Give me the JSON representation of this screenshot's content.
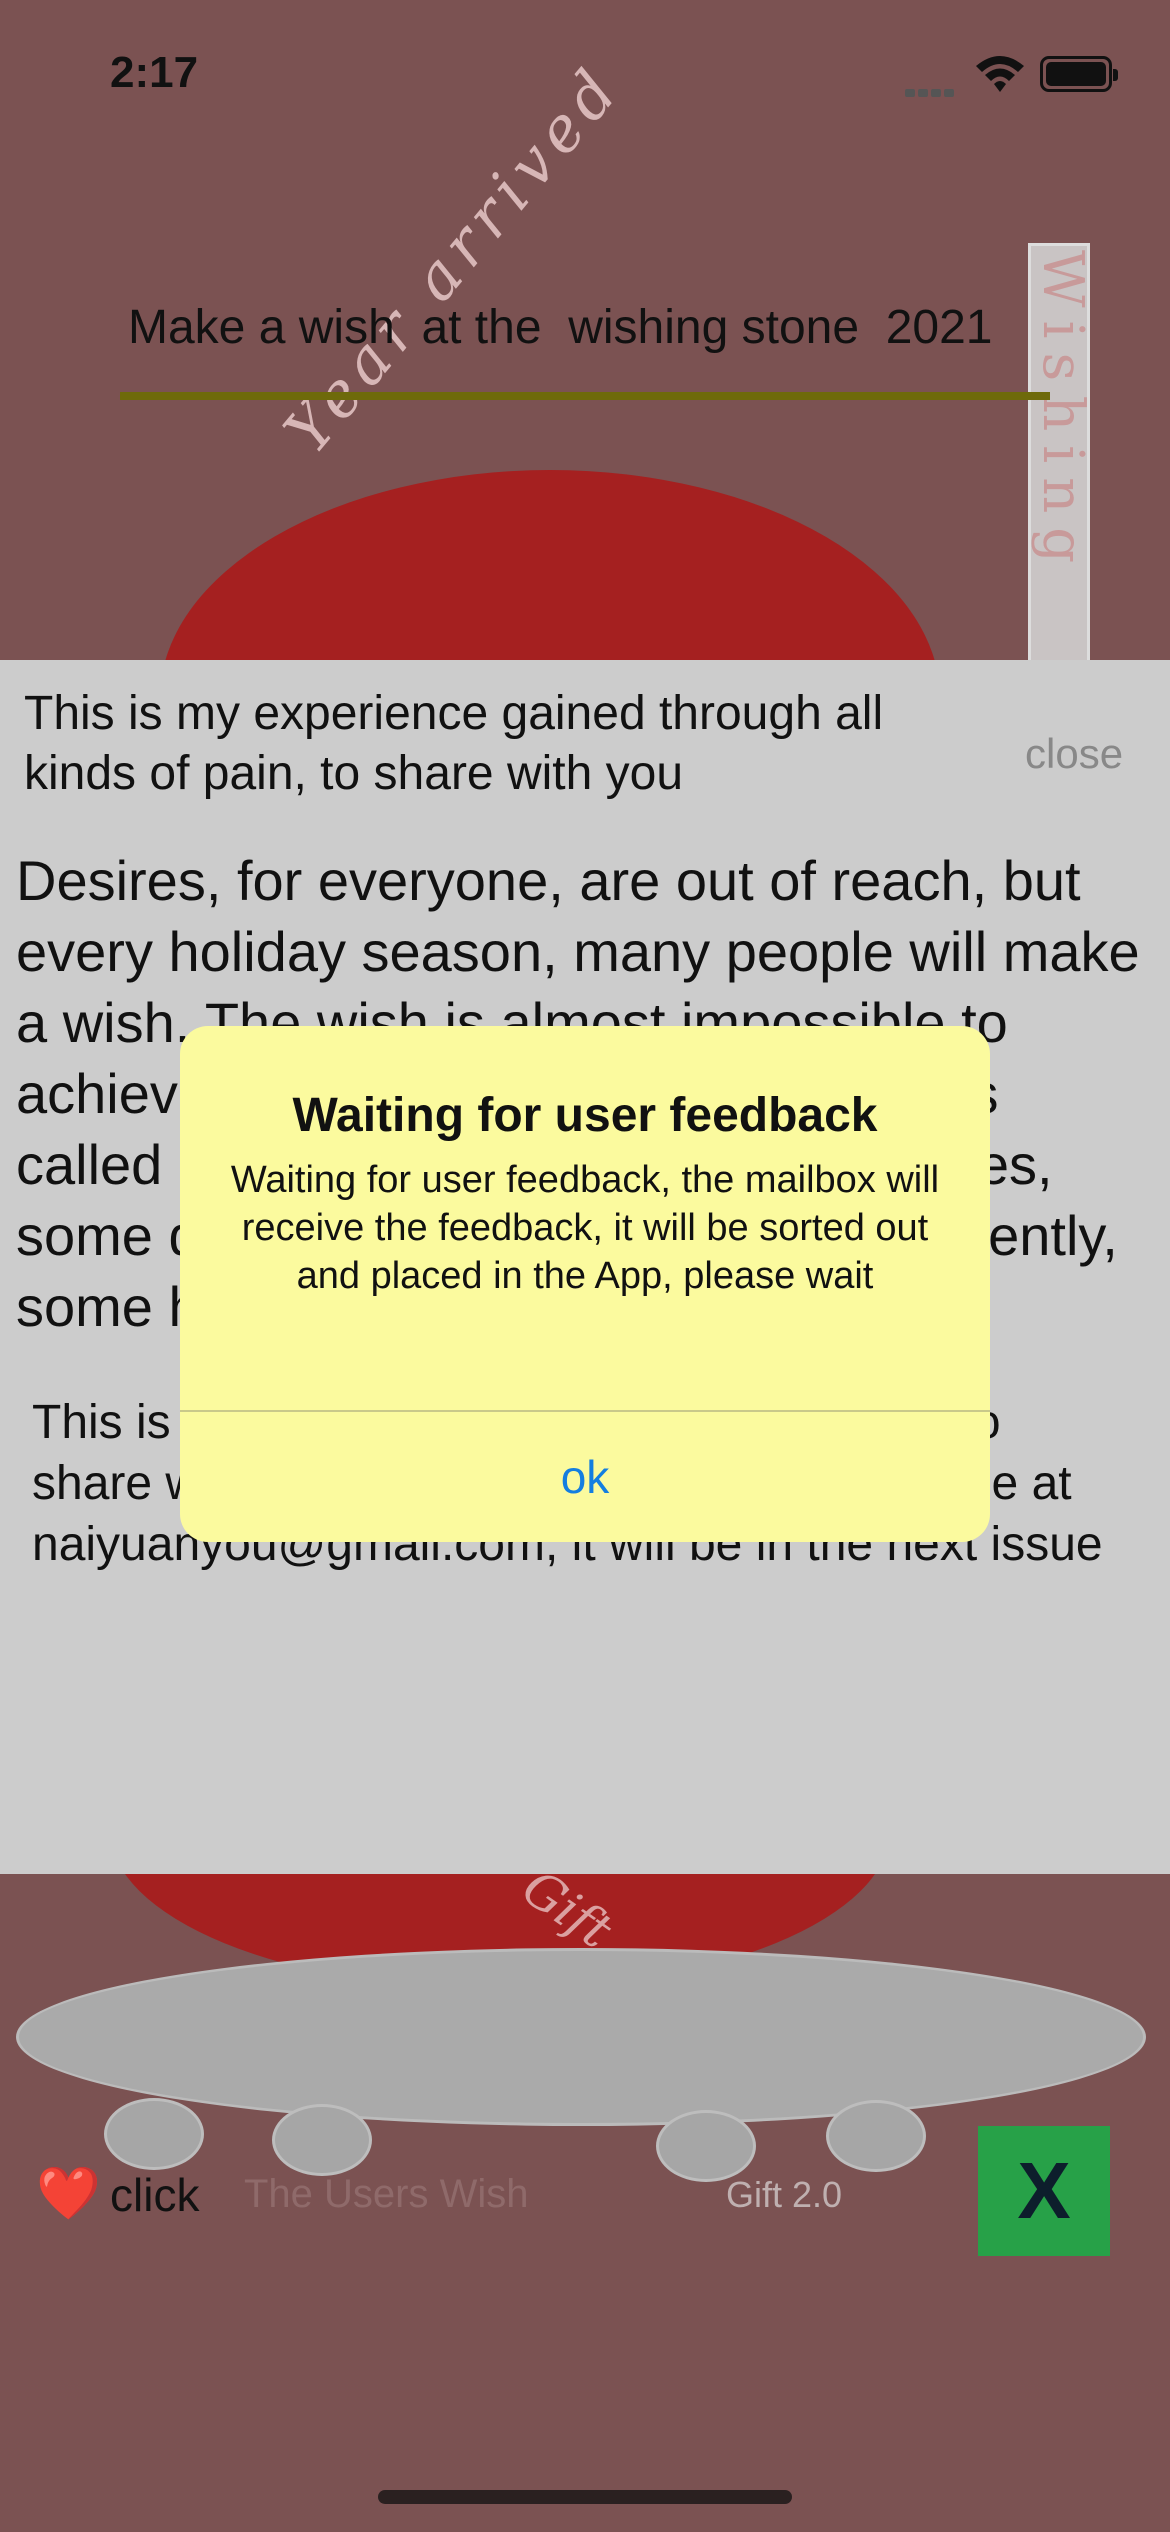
{
  "status_bar": {
    "time": "2:17",
    "icons": [
      "signal-dots-icon",
      "wifi-icon",
      "battery-icon"
    ]
  },
  "header": {
    "title": "Make a wish  at the  wishing stone  2021"
  },
  "decor": {
    "sign_text": "Wishing",
    "arc_text": "Year arrived",
    "gift_text": "Gift"
  },
  "panel": {
    "header": "This is my experience gained through all kinds of pain, to share with you",
    "close_label": "close",
    "body": "Desires, for everyone, are out of reach, but every holiday season, many people will make a wish. The wish is almost impossible to achieve, a wish that is difficult to fulfill is called a wish. Some people make wishes, some quietly, some silently, some frequently, some hope for the best, some",
    "footer": "This is my experience gained through pain, to share with you. If you have a story, contact me at naiyuanyou@gmail.com, it will be in the next issue"
  },
  "alert": {
    "title": "Waiting for user feedback",
    "message": "Waiting for user feedback, the mailbox will receive the feedback, it will be sorted out and placed in the App, please wait",
    "ok_label": "ok"
  },
  "bottom_bar": {
    "heart": "❤️",
    "click_label": "click",
    "users_wish_label": "The Users Wish",
    "version_label": "Gift 2.0",
    "close_button_label": "X"
  },
  "colors": {
    "background": "#7b5252",
    "stone_red": "#a52020",
    "panel_gray": "#cccccc",
    "alert_yellow": "#fbfa9e",
    "link_blue": "#147ee0",
    "close_green": "#27a148",
    "underline_olive": "#6e6a0a"
  }
}
